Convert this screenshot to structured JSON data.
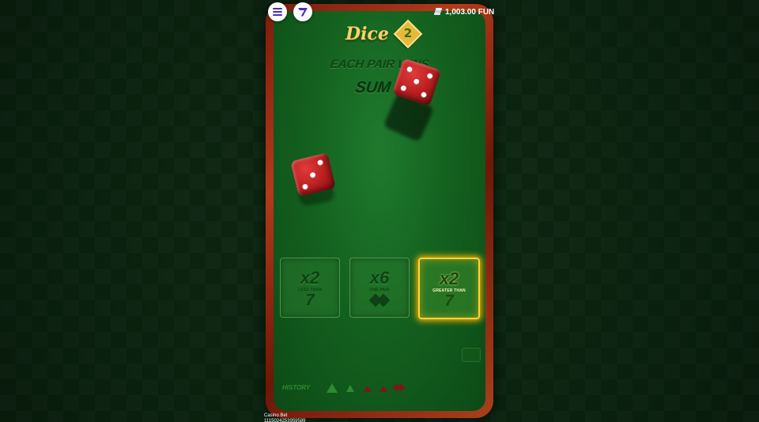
{
  "header": {
    "balance": "1,003.00 FUN"
  },
  "logo": {
    "text": "Dice",
    "badge": "2"
  },
  "rule": {
    "line1": "EACH PAIR WINS",
    "line2": "SUM 8"
  },
  "bets": [
    {
      "multiplier": "x2",
      "label": "LESS THAN",
      "target": "7",
      "selected": false
    },
    {
      "multiplier": "x6",
      "label": "ONE PAIR",
      "target": "",
      "selected": false
    },
    {
      "multiplier": "x2",
      "label": "GREATER THAN",
      "target": "7",
      "selected": true
    }
  ],
  "history": {
    "label": "HISTORY",
    "items": [
      {
        "shape": "triangle-up",
        "color": "#2e8b2e"
      },
      {
        "shape": "triangle-up",
        "color": "#2e8b2e"
      },
      {
        "shape": "triangle-down",
        "color": "#7a1a12"
      },
      {
        "shape": "triangle-down",
        "color": "#7a1a12"
      },
      {
        "shape": "diamond-pair",
        "color": "#7a1a12"
      }
    ]
  },
  "dice": [
    {
      "value": 5,
      "color": "#c62828"
    },
    {
      "value": 3,
      "color": "#c62828"
    }
  ],
  "footer": {
    "line1": "Casino Bet",
    "line2": "1115024253959589"
  },
  "icons": {
    "menu": "menu-icon",
    "brand": "brand-logo-icon",
    "balance": "coin-stack-icon"
  },
  "colors": {
    "felt": "#14621f",
    "frame": "#a33a1a",
    "highlight": "#ffd23a"
  }
}
